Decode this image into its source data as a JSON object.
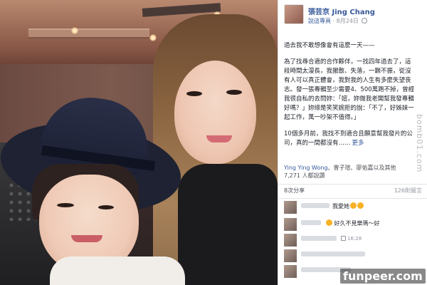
{
  "post": {
    "author": "張芸京 Jing Chang",
    "subline_link": "說這專頁",
    "subline_date": "8月24日",
    "paragraphs": [
      "過去我不敢想像會有這麼一天——",
      "為了找尋合適的合作夥伴，一找四年過去了，這段時間太漫長，我撤散、失落，一蹶不振，從沒有人可以真正體會，我對我的人生有多麼失望丧志。發一張專輯至少需要4、500萬跑不掉，曾經我很自私的去問妳：「妞，妳做我老闆幫我發專輯好嗎？」妳總是笑笑婉拒的說：「不了，好姊妹一起工作，萬一吵架不值得。」",
      "10個多月前，我找不到適合且願意幫我發片的公司，真的一間都沒有"
    ],
    "more_label": "更多",
    "likes_names": "Ying Ying Wong",
    "likes_rest": "、曾子瑄、廖佑嘉以及其他",
    "likes_count": "7,271 人都說讚",
    "shares": "8次分享",
    "comments_count": "126則留言",
    "comments": [
      {
        "text": "我愛她",
        "meta": ""
      },
      {
        "text": "好久不見樂瑪～好",
        "meta": ""
      },
      {
        "text": "",
        "meta": "16:28"
      },
      {
        "text": "",
        "meta": ""
      },
      {
        "text": "",
        "meta": ""
      }
    ]
  },
  "watermarks": {
    "side": "bomb01.com",
    "bottom": "funpeer.com"
  },
  "colors": {
    "link": "#365899",
    "meta": "#90949c",
    "text": "#1d2129"
  }
}
